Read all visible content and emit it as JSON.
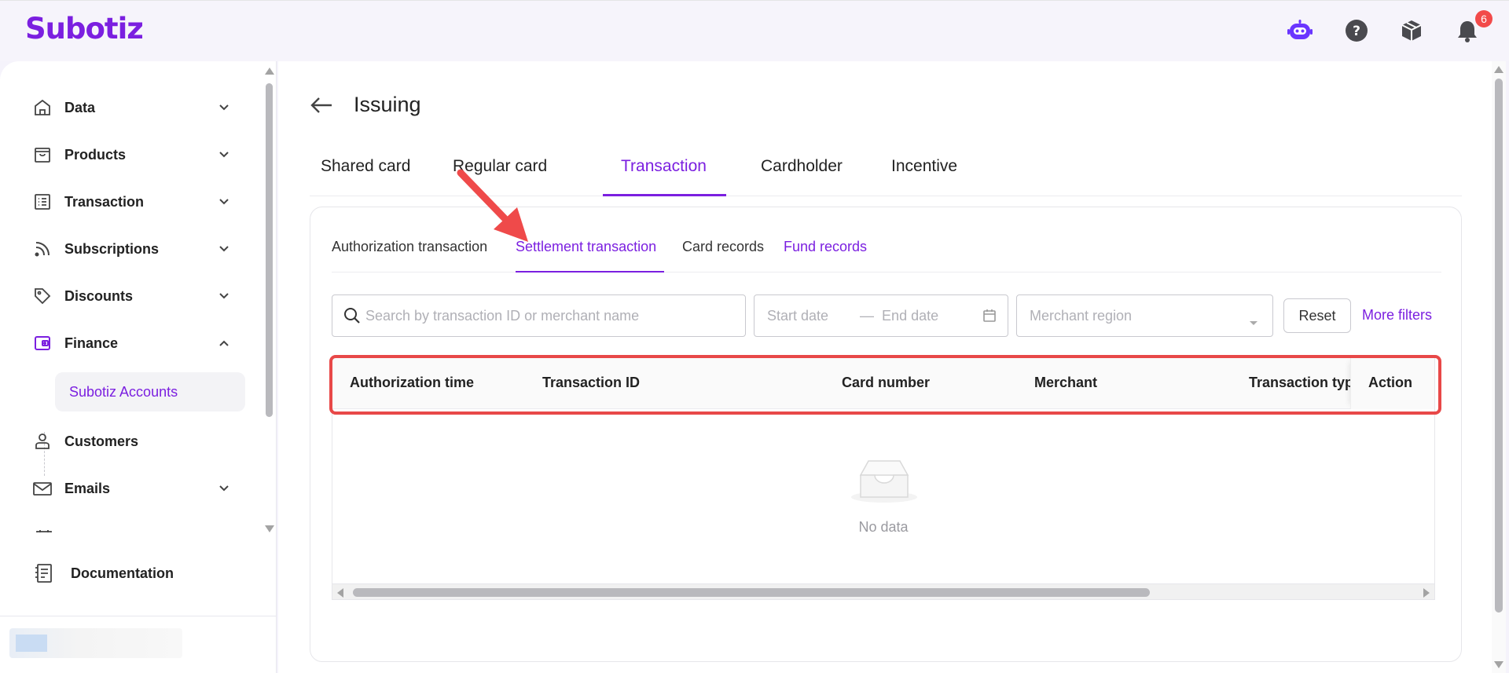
{
  "app": {
    "logo": "Subotiz"
  },
  "topbar": {
    "notification_count": "6"
  },
  "sidebar": {
    "items": [
      {
        "label": "Data",
        "icon": "home-icon"
      },
      {
        "label": "Products",
        "icon": "store-icon"
      },
      {
        "label": "Transaction",
        "icon": "list-icon"
      },
      {
        "label": "Subscriptions",
        "icon": "rss-icon"
      },
      {
        "label": "Discounts",
        "icon": "tag-icon"
      },
      {
        "label": "Finance",
        "icon": "wallet-icon"
      },
      {
        "label": "Customers",
        "icon": "user-icon"
      },
      {
        "label": "Emails",
        "icon": "mail-icon"
      }
    ],
    "sub_item": "Subotiz Accounts",
    "documentation": "Documentation"
  },
  "page": {
    "title": "Issuing",
    "tabs": [
      "Shared card",
      "Regular card",
      "Transaction",
      "Cardholder",
      "Incentive"
    ],
    "active_tab": "Transaction"
  },
  "subtabs": [
    "Authorization transaction",
    "Settlement transaction",
    "Card records",
    "Fund records"
  ],
  "filters": {
    "search_placeholder": "Search by transaction ID or merchant name",
    "start_date": "Start date",
    "end_date": "End date",
    "date_sep": "—",
    "merchant_region": "Merchant region",
    "reset": "Reset",
    "more_filters": "More filters"
  },
  "table": {
    "columns": [
      "Authorization time",
      "Transaction ID",
      "Card number",
      "Merchant",
      "Transaction type",
      "Action"
    ],
    "empty_text": "No data"
  },
  "colors": {
    "accent": "#7b1fe0",
    "highlight": "#e84848",
    "badge": "#f24a4a"
  }
}
